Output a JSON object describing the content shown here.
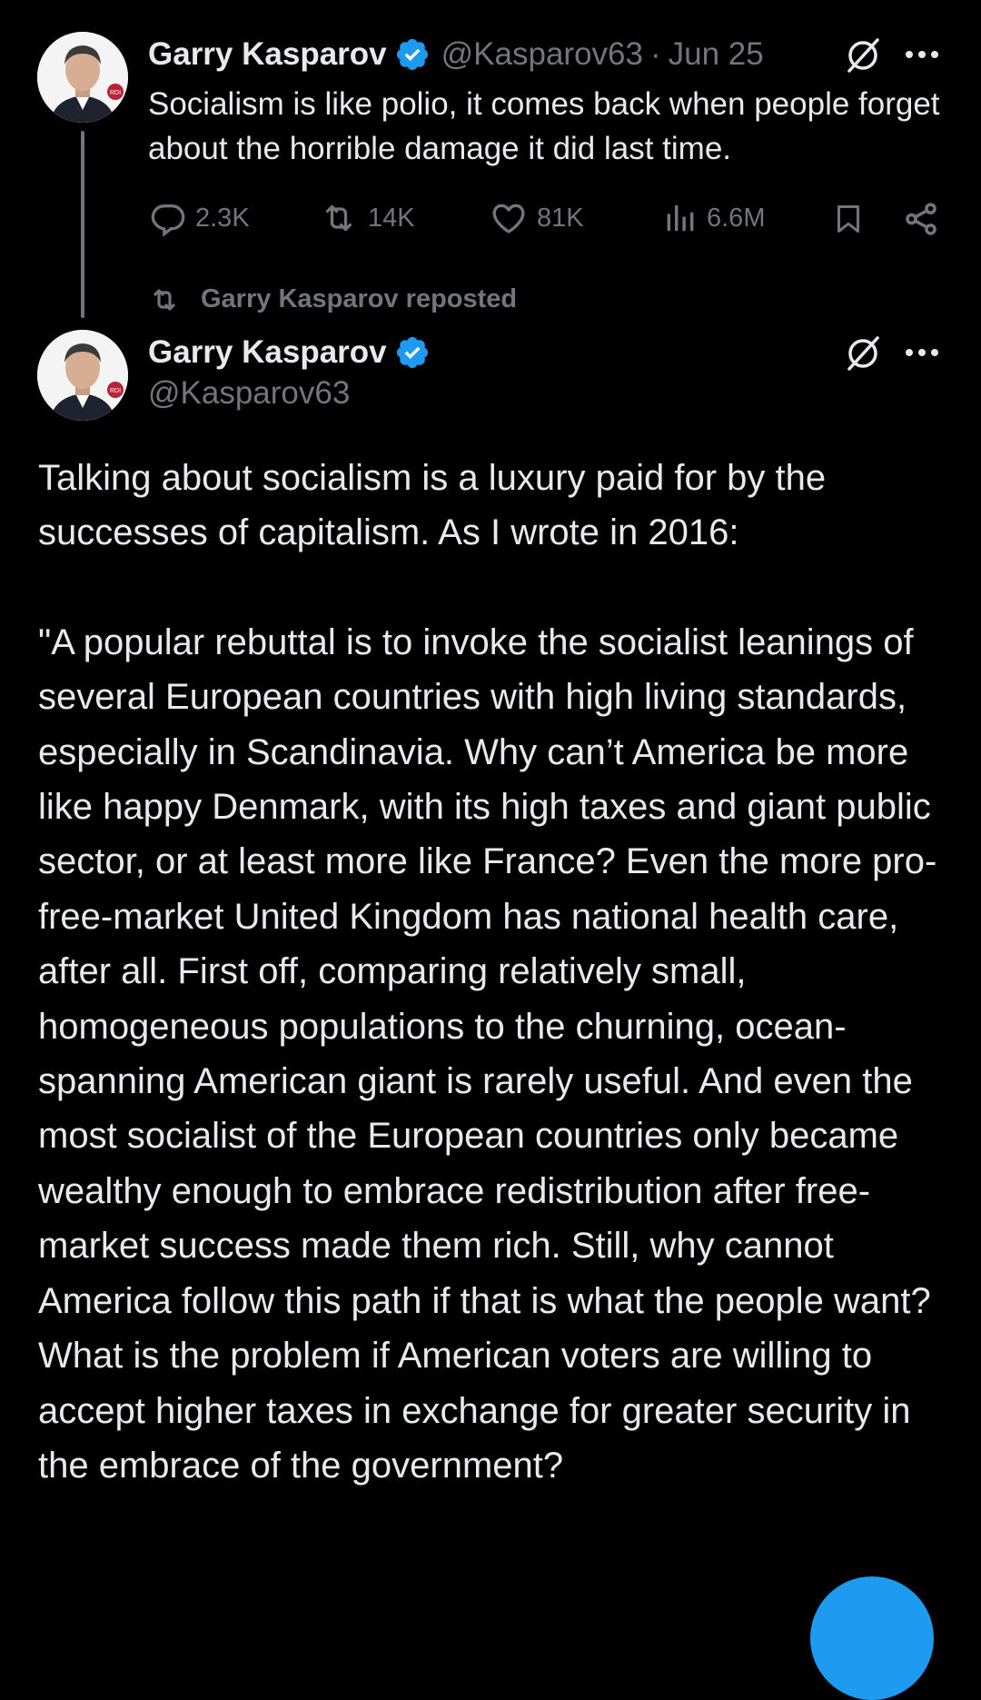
{
  "first_tweet": {
    "author_name": "Garry Kasparov",
    "handle": "@Kasparov63",
    "separator": "·",
    "date": "Jun 25",
    "text": "Socialism is like polio, it comes back when people forget about the horrible damage it did last time.",
    "replies": "2.3K",
    "reposts": "14K",
    "likes": "81K",
    "views": "6.6M"
  },
  "repost_banner": {
    "label": "Garry Kasparov reposted"
  },
  "second_tweet": {
    "author_name": "Garry Kasparov",
    "handle": "@Kasparov63",
    "paragraph_1": "Talking about socialism is a luxury paid for by the successes of capitalism. As I wrote in 2016:",
    "paragraph_2": "\"A popular rebuttal is to invoke the socialist leanings of several European countries with high living standards, especially in Scandinavia. Why can’t America be more like happy Denmark, with its high taxes and giant public sector, or at least more like France? Even the more pro-free-market United Kingdom has national health care, after all. First off, comparing relatively small, homogeneous populations to the churning, ocean-spanning American giant is rarely useful. And even the most socialist of the European countries only became wealthy enough to embrace redistribution after free-market success made them rich. Still, why cannot America follow this path if that is what the people want? What is the problem if American voters are willing to accept higher taxes in exchange for greater security in the embrace of the government?"
  },
  "avatar_badge": "RDI",
  "colors": {
    "background": "#000000",
    "text": "#e7e9ea",
    "muted": "#71767b",
    "verified": "#1d9bf0",
    "fab": "#1d9bf0"
  },
  "icons": [
    "verified-badge-icon",
    "grok-icon",
    "more-icon",
    "reply-icon",
    "repost-icon",
    "like-icon",
    "views-icon",
    "bookmark-icon",
    "share-icon"
  ]
}
